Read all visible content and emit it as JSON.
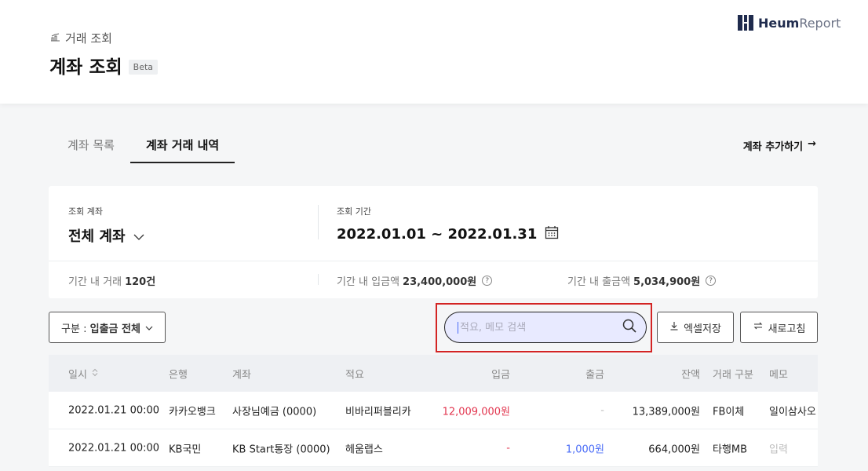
{
  "header": {
    "breadcrumb": "거래 조회",
    "title": "계좌 조회",
    "badge": "Beta",
    "brand_bold": "Heum",
    "brand_light": "Report"
  },
  "tabs": [
    {
      "label": "계좌 목록",
      "active": false
    },
    {
      "label": "계좌 거래 내역",
      "active": true
    }
  ],
  "add_account": {
    "label": "계좌 추가하기",
    "arrow": "→"
  },
  "filters": {
    "account_label": "조회 계좌",
    "account_value": "전체 계좌",
    "period_label": "조회 기간",
    "period_value": "2022.01.01 ~ 2022.01.31"
  },
  "summary": {
    "count_label": "기간 내 거래",
    "count_value": "120건",
    "deposit_label": "기간 내 입금액",
    "deposit_value": "23,400,000원",
    "withdraw_label": "기간 내 출금액",
    "withdraw_value": "5,034,900원"
  },
  "toolbar": {
    "type_prefix": "구분 : ",
    "type_value": "입출금 전체",
    "search_placeholder": "적요, 메모 검색",
    "excel_label": "엑셀저장",
    "refresh_label": "새로고침"
  },
  "table": {
    "columns": [
      "일시",
      "은행",
      "계좌",
      "적요",
      "입금",
      "출금",
      "잔액",
      "거래 구분",
      "메모"
    ],
    "rows": [
      {
        "datetime": "2022.01.21 00:00",
        "bank": "카카오뱅크",
        "account": "사장님예금 (0000)",
        "summary": "비바리퍼블리카",
        "deposit": "12,009,000원",
        "withdraw": "-",
        "balance": "13,389,000원",
        "type": "FB이체",
        "memo": "일이삼사오"
      },
      {
        "datetime": "2022.01.21 00:00",
        "bank": "KB국민",
        "account": "KB Start통장 (0000)",
        "summary": "헤움랩스",
        "deposit": "-",
        "withdraw": "1,000원",
        "balance": "664,000원",
        "type": "타행MB",
        "memo": "입력"
      }
    ]
  },
  "colors": {
    "accent": "#4a6cf7",
    "deposit": "#e2364f",
    "highlight": "#d32424"
  }
}
